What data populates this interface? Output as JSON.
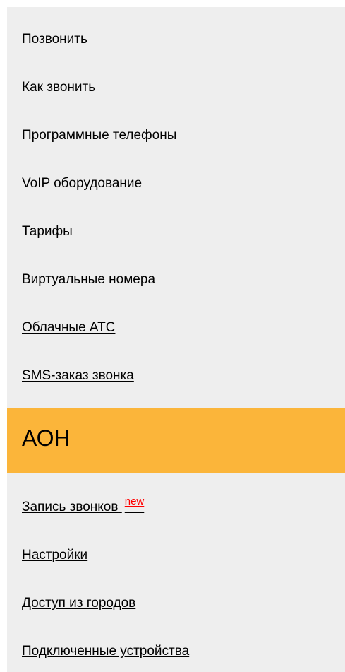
{
  "menu": {
    "items_top": [
      {
        "label": "Позвонить"
      },
      {
        "label": "Как звонить"
      },
      {
        "label": "Программные телефоны"
      },
      {
        "label": "VoIP оборудование"
      },
      {
        "label": "Тарифы"
      },
      {
        "label": "Виртуальные номера"
      },
      {
        "label": "Облачные АТС"
      },
      {
        "label": "SMS-заказ звонка"
      }
    ],
    "active": {
      "label": "АОН"
    },
    "items_bottom": [
      {
        "label": "Запись звонков",
        "badge": "new"
      },
      {
        "label": "Настройки"
      },
      {
        "label": "Доступ из городов"
      },
      {
        "label": "Подключенные устройства"
      }
    ]
  },
  "colors": {
    "sidebar_background": "#eeeeee",
    "active_background": "#fbb53a",
    "badge_color": "#ff0000",
    "link_color": "#000000"
  }
}
